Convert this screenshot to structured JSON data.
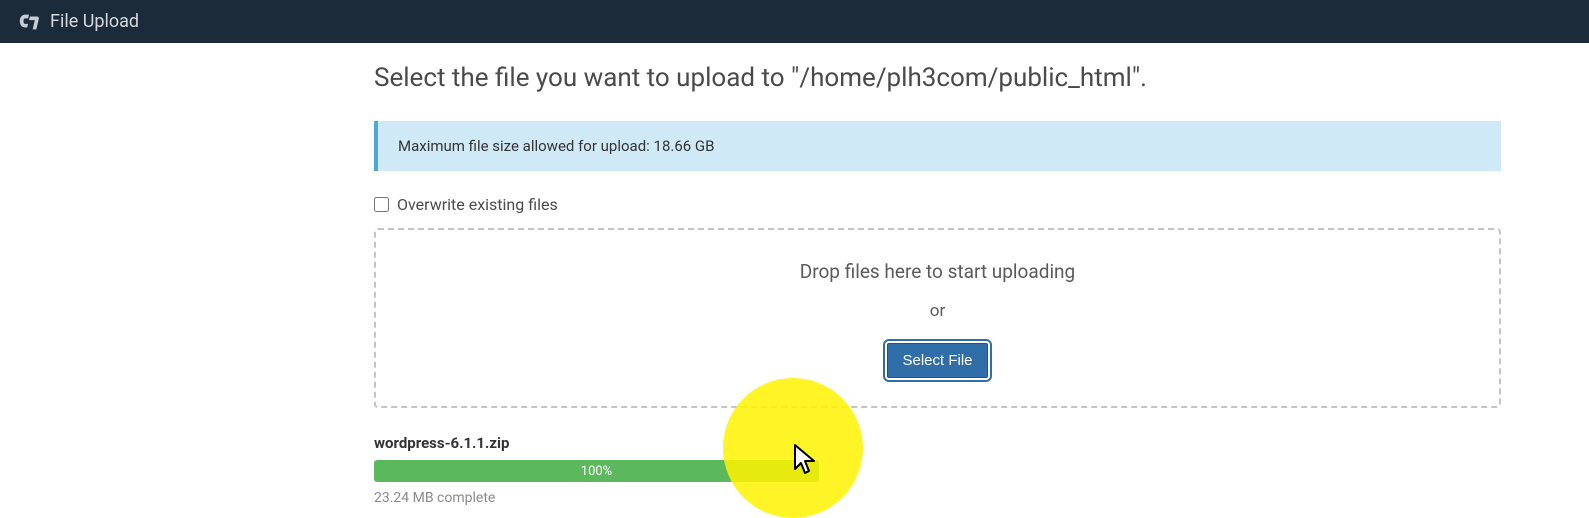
{
  "header": {
    "title": "File Upload"
  },
  "heading": "Select the file you want to upload to \"/home/plh3com/public_html\".",
  "info_message": "Maximum file size allowed for upload: 18.66 GB",
  "overwrite_label": "Overwrite existing files",
  "dropzone": {
    "drop_text": "Drop files here to start uploading",
    "or_text": "or",
    "button_label": "Select File"
  },
  "upload": {
    "filename": "wordpress-6.1.1.zip",
    "progress_text": "100%",
    "complete_text": "23.24 MB complete"
  }
}
